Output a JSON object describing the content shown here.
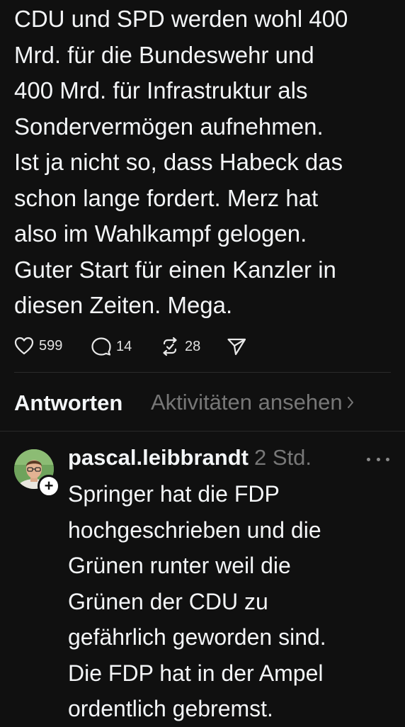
{
  "post": {
    "text": "CDU und SPD werden wohl 400\nMrd. für die Bundeswehr und\n400 Mrd. für Infrastruktur als\nSondervermögen aufnehmen.\nIst ja nicht so, dass Habeck das\nschon lange fordert. Merz hat\nalso im Wahlkampf gelogen.\nGuter Start für einen Kanzler in\ndiesen Zeiten. Mega.",
    "actions": {
      "likes": "599",
      "replies": "14",
      "reposts": "28"
    },
    "icons": [
      "heart-icon",
      "comment-icon",
      "repost-icon",
      "send-icon"
    ]
  },
  "tabs": {
    "replies_label": "Antworten",
    "activity_label": "Aktivitäten ansehen"
  },
  "reply": {
    "username": "pascal.leibbrandt",
    "time": "2 Std.",
    "text": "Springer hat die FDP\nhochgeschrieben und die\nGrünen runter weil die\nGrünen der CDU zu\ngefährlich geworden sind.\nDie FDP hat in der Ampel\nordentlich gebremst."
  },
  "colors": {
    "background": "#101010",
    "text": "#f3f5f7",
    "muted": "#777777",
    "divider": "#2a2a2a"
  }
}
